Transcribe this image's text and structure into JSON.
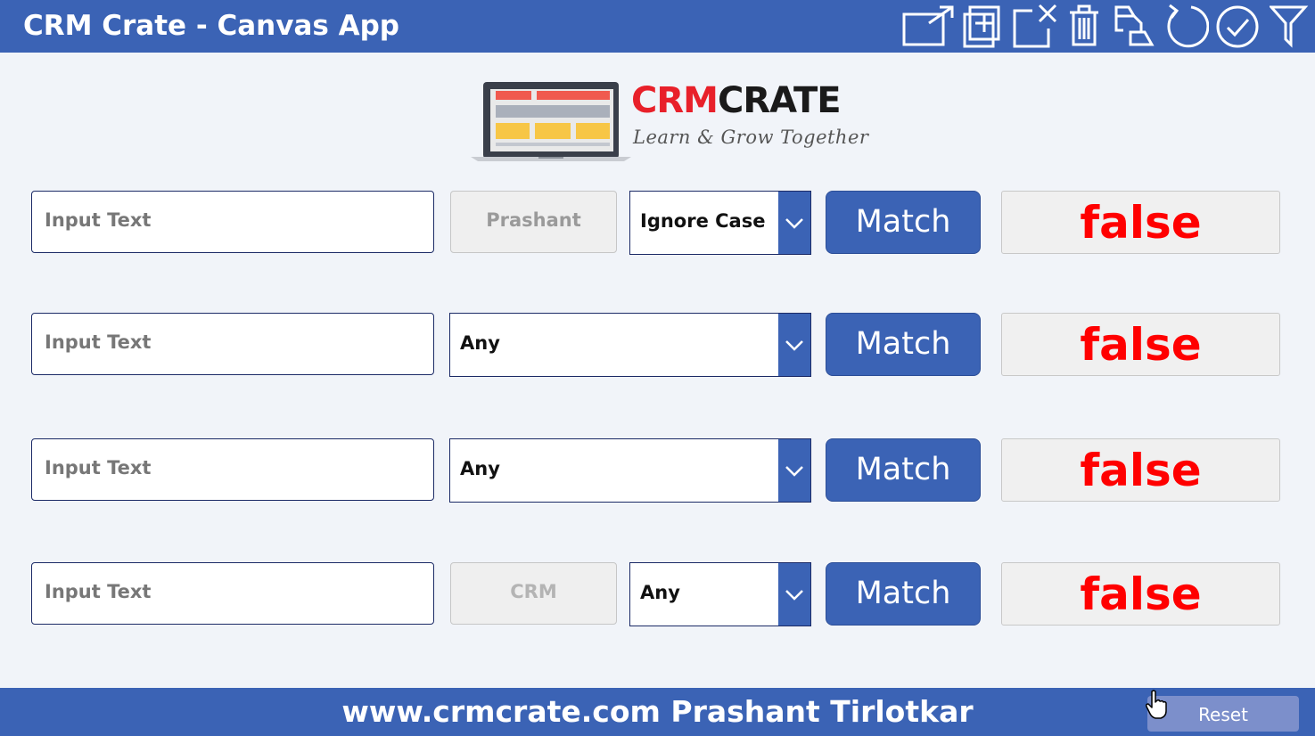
{
  "header": {
    "title": "CRM Crate - Canvas App",
    "icons": [
      "open-external-icon",
      "add-icon",
      "cancel-icon",
      "trash-icon",
      "arrange-icon",
      "refresh-icon",
      "check-icon",
      "filter-icon"
    ]
  },
  "logo": {
    "part1": "CRM",
    "part2": "CRATE",
    "tagline": "Learn & Grow Together"
  },
  "rows": [
    {
      "input_placeholder": "Input Text",
      "readonly_value": "Prashant",
      "dropdown_value": "Ignore Case",
      "button_label": "Match",
      "result": "false"
    },
    {
      "input_placeholder": "Input Text",
      "dropdown_value": "Any",
      "button_label": "Match",
      "result": "false"
    },
    {
      "input_placeholder": "Input Text",
      "dropdown_value": "Any",
      "button_label": "Match",
      "result": "false"
    },
    {
      "input_placeholder": "Input Text",
      "readonly_value": "CRM",
      "dropdown_value": "Any",
      "button_label": "Match",
      "result": "false"
    }
  ],
  "footer": {
    "text": "www.crmcrate.com Prashant Tirlotkar",
    "reset_label": "Reset"
  },
  "colors": {
    "brand_blue": "#3b63b5",
    "result_red": "#ff0000",
    "logo_red": "#e8202a"
  }
}
